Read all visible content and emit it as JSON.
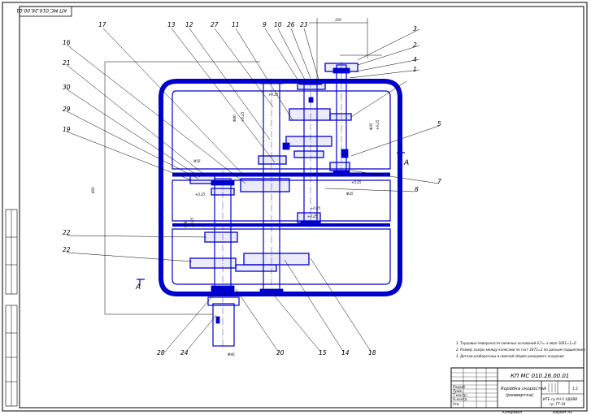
{
  "stamp_code": "КП МС 010.26.00.01",
  "callouts": [
    "17",
    "13",
    "12",
    "27",
    "11",
    "9",
    "10",
    "26",
    "23",
    "3",
    "2",
    "4",
    "1",
    "16",
    "21",
    "30",
    "29",
    "19",
    "5",
    "7",
    "8",
    "22",
    "22",
    "28",
    "24",
    "20",
    "15",
    "14",
    "18"
  ],
  "section_marker": "A",
  "notes": [
    "1. Торцовые поверхности смежных оснований 0,5= а перп 1001=1=0",
    "2. Размер зазора между колесами по гост 2071=3 по данным подшипника",
    "3. Детали разборочных в связной сборке шлицевого оседания"
  ],
  "title_block": {
    "code": "КП МС 010.26.00.01",
    "name_line1": "Коробка скоростей",
    "name_line2": "(развертка)",
    "org_line1": "ИТБ гр.АЧ-2 ХДАВВ",
    "org_line2": "гр. ТТ-18",
    "sheet_label": "1:2",
    "row_labels": [
      "Разраб.",
      "Пров.",
      "Т.контр.",
      "Н.контр.",
      "Утв."
    ],
    "bottom_left": "Копировал",
    "bottom_right": "Формат А3"
  },
  "dims": [
    "400",
    "350",
    "+0.25",
    "Ф40",
    "Ф35",
    "Ф30",
    "M16"
  ]
}
